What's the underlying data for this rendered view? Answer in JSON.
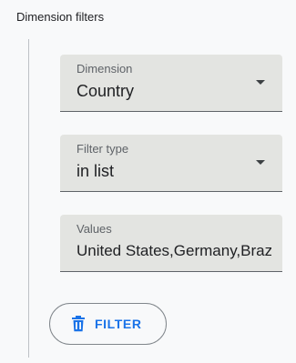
{
  "section": {
    "title": "Dimension filters"
  },
  "dimension": {
    "label": "Dimension",
    "value": "Country"
  },
  "filter_type": {
    "label": "Filter type",
    "value": "in list"
  },
  "values_field": {
    "label": "Values",
    "value": "United States,Germany,Brazil"
  },
  "filter_button": {
    "label": "FILTER",
    "icon": "delete-icon"
  },
  "colors": {
    "accent": "#1a73e8",
    "field_background": "#e3e4e1",
    "page_background": "#f8f9fa"
  }
}
